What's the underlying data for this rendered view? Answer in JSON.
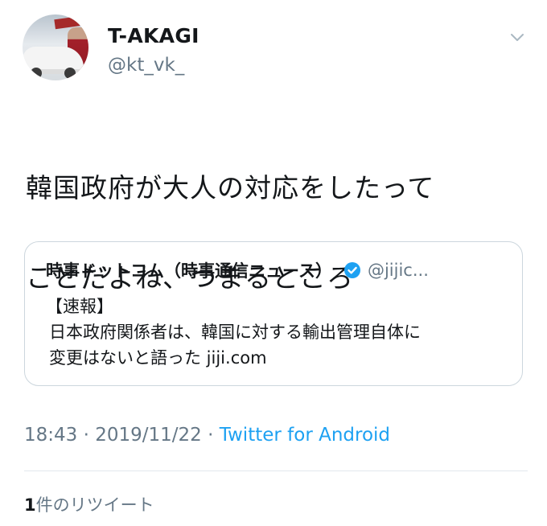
{
  "author": {
    "display_name": "T-AKAGI",
    "handle": "@kt_vk_"
  },
  "tweet": {
    "text_line_1": "韓国政府が大人の対応をしたって",
    "text_line_2": "ことだよね、つまるところ"
  },
  "quoted_tweet": {
    "author_name": "時事ドットコム（時事通信ニュース）",
    "author_handle": "@jijic...",
    "tag": "【速報】",
    "body_line_1": "日本政府関係者は、韓国に対する輸出管理自体に",
    "body_line_2": "変更はないと語った jiji.com"
  },
  "meta": {
    "time": "18:43",
    "separator": " · ",
    "date": "2019/11/22",
    "source": "Twitter for Android"
  },
  "stats": {
    "retweet_count": "1",
    "retweet_label": "件のリツイート"
  },
  "icons": {
    "caret": "chevron-down-icon",
    "verified": "verified-badge-icon"
  },
  "colors": {
    "accent": "#1da1f2",
    "muted": "#657786",
    "text": "#14171a",
    "border": "#ccd6dd"
  }
}
